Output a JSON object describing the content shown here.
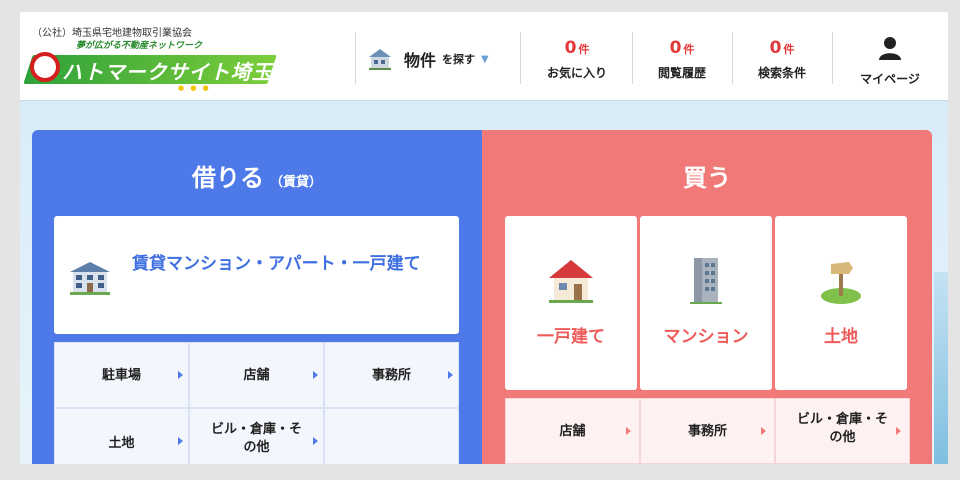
{
  "header": {
    "logo": {
      "org": "（公社）埼玉県宅地建物取引業協会",
      "tagline": "夢が広がる不動産ネットワーク",
      "name": "ハトマークサイト埼玉"
    },
    "search": {
      "big": "物件",
      "small": "を探す",
      "icon": "house-icon",
      "caret": "chevron-down-icon"
    },
    "counts": [
      {
        "num": "0",
        "unit": "件",
        "label": "お気に入り"
      },
      {
        "num": "0",
        "unit": "件",
        "label": "閲覧履歴"
      },
      {
        "num": "0",
        "unit": "件",
        "label": "検索条件"
      }
    ],
    "mypage": {
      "label": "マイページ",
      "icon": "person-icon"
    }
  },
  "rent": {
    "title": "借りる",
    "subtitle": "（賃貸）",
    "main": {
      "label": "賃貸マンション・アパート・一戸建て",
      "icon": "apartment-icon"
    },
    "sub": [
      "駐車場",
      "店舗",
      "事務所",
      "土地",
      "ビル・倉庫・その他"
    ]
  },
  "buy": {
    "title": "買う",
    "cards": [
      {
        "label": "一戸建て",
        "icon": "house-icon"
      },
      {
        "label": "マンション",
        "icon": "building-icon"
      },
      {
        "label": "土地",
        "icon": "land-sign-icon"
      }
    ],
    "sub": [
      "店舗",
      "事務所",
      "ビル・倉庫・その他"
    ]
  },
  "colors": {
    "rent_panel": "#4d7ae8",
    "buy_panel": "#f17a78",
    "count_red": "#e23a3a",
    "logo_green": "#2fa13a"
  }
}
